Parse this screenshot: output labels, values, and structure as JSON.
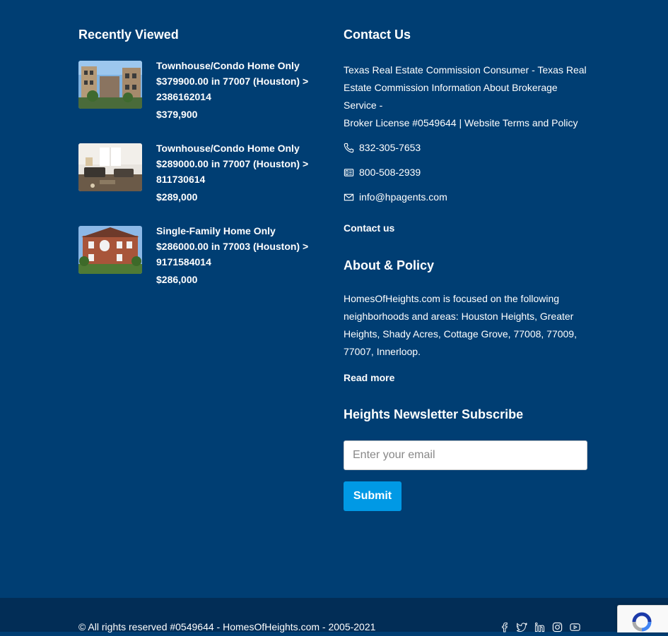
{
  "recently_viewed": {
    "heading": "Recently Viewed",
    "items": [
      {
        "title": "Townhouse/Condo Home Only $379900.00 in 77007 (Houston) > 2386162014",
        "price": "$379,900"
      },
      {
        "title": "Townhouse/Condo Home Only $289000.00 in 77007 (Houston) > 811730614",
        "price": "$289,000"
      },
      {
        "title": "Single-Family Home Only $286000.00 in 77003 (Houston) > 9171584014",
        "price": "$286,000"
      }
    ]
  },
  "contact": {
    "heading": "Contact Us",
    "text_line1": "Texas Real Estate Commission Consumer - Texas Real Estate Commission Information About Brokerage Service -",
    "text_line2": "Broker License #0549644 | Website Terms and Policy",
    "phone": "832-305-7653",
    "fax": "800-508-2939",
    "email": "info@hpagents.com",
    "contact_link": "Contact us",
    "icons": {
      "phone": "phone-icon",
      "fax": "fax-icon",
      "email": "envelope-icon"
    }
  },
  "about": {
    "heading": "About & Policy",
    "text": "HomesOfHeights.com is focused on the following neighborhoods and areas: Houston Heights, Greater Heights, Shady Acres, Cottage Grove, 77008, 77009, 77007, Innerloop.",
    "read_more": "Read more"
  },
  "newsletter": {
    "heading": "Heights Newsletter Subscribe",
    "email_placeholder": "Enter your email",
    "email_value": "",
    "submit_label": "Submit"
  },
  "footer": {
    "copyright": "© All rights reserved #0549644 - HomesOfHeights.com - 2005-2021",
    "socials": [
      "facebook-icon",
      "twitter-icon",
      "linkedin-icon",
      "instagram-icon",
      "youtube-icon"
    ]
  },
  "colors": {
    "background": "#003e73",
    "footer": "#022d56",
    "accent": "#0099e5"
  }
}
